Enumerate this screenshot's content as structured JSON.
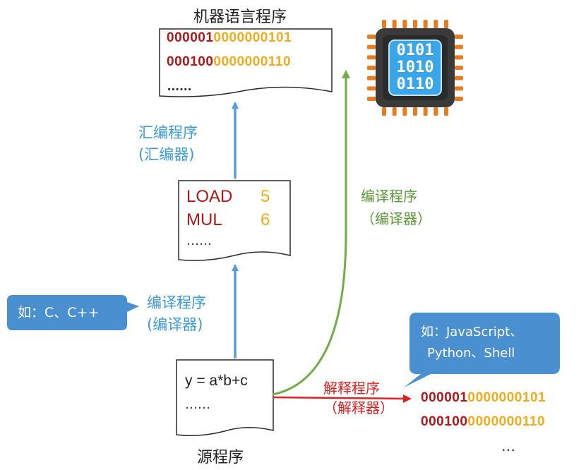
{
  "machine_program": {
    "title": "机器语言程序",
    "lines": [
      {
        "opcode": "000001",
        "operand": "0000000101"
      },
      {
        "opcode": "000100",
        "operand": "0000000110"
      }
    ],
    "ellipsis": "......"
  },
  "cpu_chip": {
    "bits": [
      "0101",
      "1010",
      "0110"
    ]
  },
  "assembly_step": {
    "label_line1": "汇编程序",
    "label_line2": "(汇编器)"
  },
  "assembly_program": {
    "lines": [
      {
        "op": "LOAD",
        "arg": "5"
      },
      {
        "op": "MUL",
        "arg": "6"
      }
    ],
    "ellipsis": "……"
  },
  "compile_step_left": {
    "label_line1": "编译程序",
    "label_line2": "(编译器)"
  },
  "compile_step_right": {
    "label_line1": "编译程序",
    "label_line2": "（编译器）"
  },
  "callout_c": {
    "text": "如：C、C++"
  },
  "source_program": {
    "code": "y = a*b+c",
    "ellipsis": "……",
    "title": "源程序"
  },
  "interpret_step": {
    "label_line1": "解释程序",
    "label_line2": "（解释器）"
  },
  "callout_scripts": {
    "line1": "如：JavaScript、",
    "line2": "Python、Shell"
  },
  "interpreted_output": {
    "lines": [
      {
        "opcode": "000001",
        "operand": "0000000101"
      },
      {
        "opcode": "000100",
        "operand": "0000000110"
      }
    ],
    "ellipsis": "…"
  },
  "colors": {
    "blue_arrow": "#5b9bd5",
    "green_arrow": "#70ad47",
    "red_arrow": "#e02020",
    "opcode_red": "#b01818",
    "operand_gold": "#f0ac1c",
    "callout_fill": "#4a8fd0",
    "chip_body": "#3a3a3a",
    "chip_pins": "#e87c22",
    "chip_core": "#3aa6e8"
  }
}
